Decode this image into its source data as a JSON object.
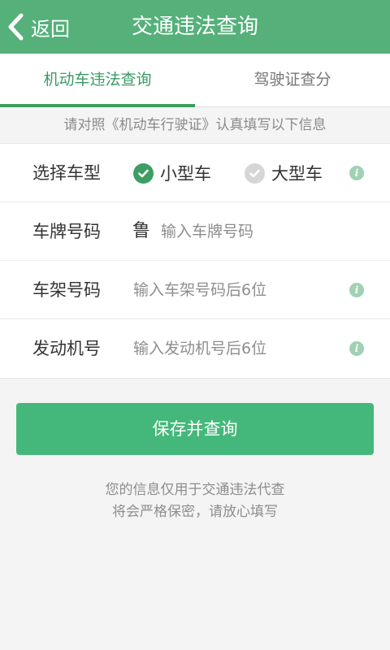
{
  "header": {
    "back_label": "返回",
    "title": "交通违法查询",
    "color": "#55b07a"
  },
  "tabs": [
    {
      "label": "机动车违法查询",
      "active": true
    },
    {
      "label": "驾驶证查分",
      "active": false
    }
  ],
  "notice": "请对照《机动车行驶证》认真填写以下信息",
  "form": {
    "vehicle_type": {
      "label": "选择车型",
      "options": [
        {
          "label": "小型车",
          "selected": true
        },
        {
          "label": "大型车",
          "selected": false
        }
      ]
    },
    "plate": {
      "label": "车牌号码",
      "prefix": "鲁",
      "placeholder": "输入车牌号码"
    },
    "frame": {
      "label": "车架号码",
      "placeholder": "输入车架号码后6位"
    },
    "engine": {
      "label": "发动机号",
      "placeholder": "输入发动机号后6位"
    }
  },
  "save_button": "保存并查询",
  "footer": {
    "line1": "您的信息仅用于交通违法代查",
    "line2": "将会严格保密，请放心填写"
  },
  "icons": {
    "back": "chevron-left-icon",
    "check": "check-circle-icon",
    "info": "info-icon"
  },
  "colors": {
    "accent": "#3d9d63",
    "button": "#44b87a",
    "check_selected": "#3d9d63",
    "check_unselected": "#d6d6d6",
    "info": "#9fd2b3"
  }
}
